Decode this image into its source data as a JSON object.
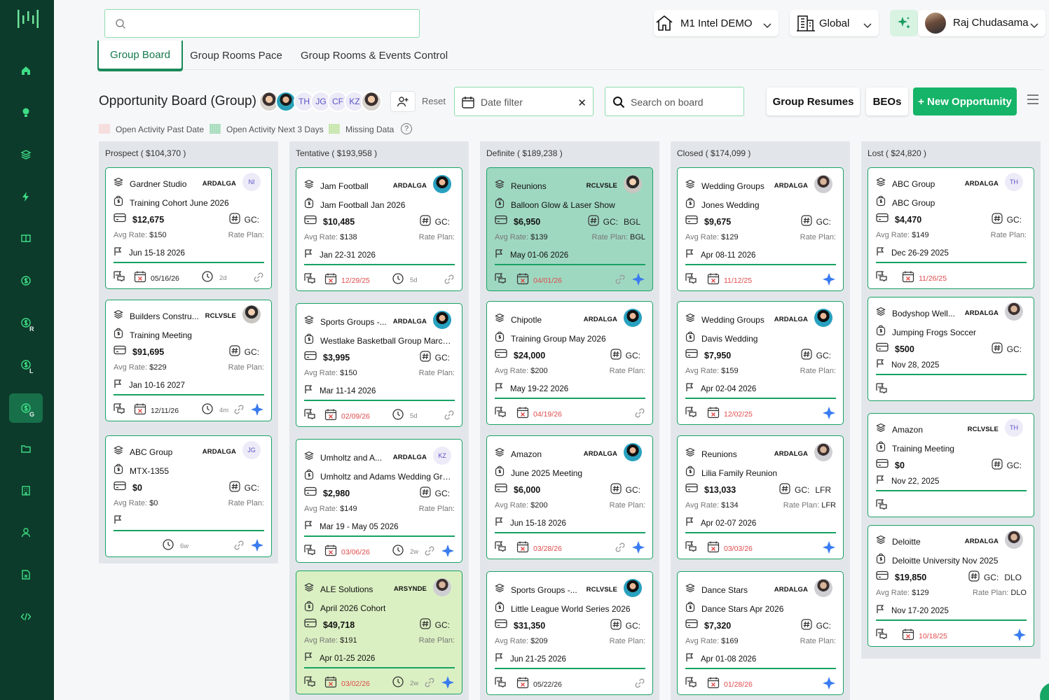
{
  "top": {
    "search_placeholder": "",
    "property": "M1 Intel DEMO",
    "scope": "Global",
    "user": "Raj Chudasama"
  },
  "tabs": [
    "Group Board",
    "Group Rooms Pace",
    "Group Rooms & Events Control"
  ],
  "board": {
    "title": "Opportunity Board (Group)",
    "avatar_initials": [
      "TH",
      "JG",
      "CF",
      "KZ"
    ],
    "reset": "Reset",
    "date_filter": "Date filter",
    "search_placeholder": "Search on board",
    "group_resumes": "Group Resumes",
    "beos": "BEOs",
    "new_opportunity": "+ New Opportunity"
  },
  "legend": {
    "items": [
      "Open Activity Past Date",
      "Open Activity Next 3 Days",
      "Missing Data"
    ],
    "help": "?",
    "colors": [
      "#f7dede",
      "#bfe6cf",
      "#d6eec1"
    ]
  },
  "colors": {
    "accent": "#17a263",
    "sidebar": "#0c3b2b",
    "danger": "#e04a4a",
    "spark": "#3a7bf0"
  },
  "labels": {
    "gc": "GC:",
    "avg_rate": "Avg Rate:",
    "rate_plan": "Rate Plan:"
  },
  "columns": [
    {
      "title": "Prospect ( $104,370 )",
      "cards": [
        {
          "company": "Gardner Studio",
          "code": "ARDALGA",
          "owner": "NI",
          "event": "Training Cohort June 2026",
          "amount": "$12,675",
          "gc": "",
          "avg_rate": "$150",
          "rate_plan": "",
          "dates": "Jun 15-18 2026",
          "foot_date": "05/16/26",
          "foot_date_red": false,
          "age": "2d",
          "link": true,
          "spark": false,
          "style": ""
        },
        {
          "company": "Builders Constru...",
          "code": "RCLVSLE",
          "owner": "",
          "owner_photo": "p1",
          "event": "Training Meeting",
          "amount": "$91,695",
          "gc": "",
          "avg_rate": "$229",
          "rate_plan": "",
          "dates": "Jan 10-16 2027",
          "foot_date": "12/11/26",
          "foot_date_red": false,
          "age": "4m",
          "link": true,
          "spark": true,
          "style": ""
        },
        {
          "company": "ABC Group",
          "code": "ARDALGA",
          "owner": "JG",
          "event": "MTX-1355",
          "amount": "$0",
          "gc": "",
          "avg_rate": "$0",
          "rate_plan": "",
          "dates": "",
          "foot_date": "",
          "foot_date_red": false,
          "age": "6w",
          "link": true,
          "spark": true,
          "style": ""
        }
      ]
    },
    {
      "title": "Tentative ( $193,958 )",
      "cards": [
        {
          "company": "Jam Football",
          "code": "ARDALGA",
          "owner": "",
          "owner_photo": "p2",
          "event": "Jam Football Jan 2026",
          "amount": "$10,485",
          "gc": "",
          "avg_rate": "$138",
          "rate_plan": "",
          "dates": "Jan 22-31 2026",
          "foot_date": "12/29/25",
          "foot_date_red": true,
          "age": "5d",
          "link": true,
          "spark": false,
          "style": ""
        },
        {
          "company": "Sports Groups -...",
          "code": "ARDALGA",
          "owner": "",
          "owner_photo": "p2",
          "event": "Westlake Basketball Group March ...",
          "amount": "$3,995",
          "gc": "",
          "avg_rate": "$150",
          "rate_plan": "",
          "dates": "Mar 11-14 2026",
          "foot_date": "02/09/26",
          "foot_date_red": true,
          "age": "5d",
          "link": true,
          "spark": false,
          "style": ""
        },
        {
          "company": "Umholtz and A...",
          "code": "ARDALGA",
          "owner": "KZ",
          "event": "Umholtz and Adams Wedding Gro...",
          "amount": "$2,980",
          "gc": "",
          "avg_rate": "$149",
          "rate_plan": "",
          "dates": "Mar 19 - May 05 2026",
          "foot_date": "03/06/26",
          "foot_date_red": true,
          "age": "2w",
          "link": true,
          "spark": true,
          "style": ""
        },
        {
          "company": "ALE Solutions",
          "code": "ARSYNDE",
          "owner": "",
          "owner_photo": "p3",
          "event": "April 2026 Cohort",
          "amount": "$49,718",
          "gc": "",
          "avg_rate": "$191",
          "rate_plan": "",
          "dates": "Apr 01-25 2026",
          "foot_date": "03/02/26",
          "foot_date_red": true,
          "age": "2w",
          "link": true,
          "spark": true,
          "style": "lime"
        }
      ]
    },
    {
      "title": "Definite ( $189,238 )",
      "cards": [
        {
          "company": "Reunions",
          "code": "RCLVSLE",
          "owner": "",
          "owner_photo": "p1",
          "event": "Balloon Glow & Laser Show",
          "amount": "$6,950",
          "gc": "BGL",
          "avg_rate": "$139",
          "rate_plan": "BGL",
          "dates": "May 01-06 2026",
          "foot_date": "04/01/26",
          "foot_date_red": true,
          "age": "",
          "link": true,
          "spark": true,
          "style": "green"
        },
        {
          "company": "Chipotle",
          "code": "ARDALGA",
          "owner": "",
          "owner_photo": "p2",
          "event": "Training Group May 2026",
          "amount": "$24,000",
          "gc": "",
          "avg_rate": "$200",
          "rate_plan": "",
          "dates": "May 19-22 2026",
          "foot_date": "04/19/26",
          "foot_date_red": true,
          "age": "",
          "link": true,
          "spark": false,
          "style": ""
        },
        {
          "company": "Amazon",
          "code": "ARDALGA",
          "owner": "",
          "owner_photo": "p2",
          "event": "June 2025 Meeting",
          "amount": "$6,000",
          "gc": "",
          "avg_rate": "$200",
          "rate_plan": "",
          "dates": "Jun 15-18 2026",
          "foot_date": "03/28/26",
          "foot_date_red": true,
          "age": "",
          "link": true,
          "spark": true,
          "style": ""
        },
        {
          "company": "Sports Groups -...",
          "code": "RCLVSLE",
          "owner": "",
          "owner_photo": "p2",
          "event": "Little League World Series 2026",
          "amount": "$31,350",
          "gc": "",
          "avg_rate": "$209",
          "rate_plan": "",
          "dates": "Jun 21-25 2026",
          "foot_date": "05/22/26",
          "foot_date_red": false,
          "age": "",
          "link": true,
          "spark": false,
          "style": ""
        }
      ]
    },
    {
      "title": "Closed ( $174,099 )",
      "cards": [
        {
          "company": "Wedding Groups",
          "code": "ARDALGA",
          "owner": "",
          "owner_photo": "p3",
          "event": "Jones Wedding",
          "amount": "$9,675",
          "gc": "",
          "avg_rate": "$129",
          "rate_plan": "",
          "dates": "Apr 08-11 2026",
          "foot_date": "11/12/25",
          "foot_date_red": true,
          "age": "",
          "link": false,
          "spark": true,
          "style": ""
        },
        {
          "company": "Wedding Groups",
          "code": "ARDALGA",
          "owner": "",
          "owner_photo": "p2",
          "event": "Davis Wedding",
          "amount": "$7,950",
          "gc": "",
          "avg_rate": "$159",
          "rate_plan": "",
          "dates": "Apr 02-04 2026",
          "foot_date": "12/02/25",
          "foot_date_red": true,
          "age": "",
          "link": false,
          "spark": true,
          "style": ""
        },
        {
          "company": "Reunions",
          "code": "ARDALGA",
          "owner": "",
          "owner_photo": "p3",
          "event": "Lilia Family Reunion",
          "amount": "$13,033",
          "gc": "LFR",
          "avg_rate": "$134",
          "rate_plan": "LFR",
          "dates": "Apr 02-07 2026",
          "foot_date": "03/03/26",
          "foot_date_red": true,
          "age": "",
          "link": false,
          "spark": true,
          "style": ""
        },
        {
          "company": "Dance Stars",
          "code": "ARDALGA",
          "owner": "",
          "owner_photo": "p3",
          "event": "Dance Stars Apr 2026",
          "amount": "$7,320",
          "gc": "",
          "avg_rate": "$169",
          "rate_plan": "",
          "dates": "Apr 01-08 2026",
          "foot_date": "01/28/26",
          "foot_date_red": true,
          "age": "",
          "link": false,
          "spark": true,
          "style": ""
        }
      ]
    },
    {
      "title": "Lost ( $24,820 )",
      "cards": [
        {
          "company": "ABC Group",
          "code": "ARDALGA",
          "owner": "TH",
          "event": "ABC Group",
          "amount": "$4,470",
          "gc": "",
          "avg_rate": "$149",
          "rate_plan": "",
          "dates": "Dec 26-29 2025",
          "foot_date": "11/26/25",
          "foot_date_red": true,
          "age": "",
          "link": false,
          "spark": false,
          "style": ""
        },
        {
          "company": "Bodyshop Well...",
          "code": "ARDALGA",
          "owner": "",
          "owner_photo": "p3",
          "event": "Jumping Frogs Soccer",
          "amount": "$500",
          "gc": "",
          "avg_rate": null,
          "rate_plan": null,
          "dates": "Nov 28, 2025",
          "foot_date": "",
          "foot_date_red": false,
          "age": "",
          "link": false,
          "spark": false,
          "style": ""
        },
        {
          "company": "Amazon",
          "code": "RCLVSLE",
          "owner": "TH",
          "event": "Training Meeting",
          "amount": "$0",
          "gc": "",
          "avg_rate": null,
          "rate_plan": null,
          "dates": "Nov 22, 2025",
          "foot_date": "",
          "foot_date_red": false,
          "age": "",
          "link": false,
          "spark": false,
          "style": ""
        },
        {
          "company": "Deloitte",
          "code": "ARDALGA",
          "owner": "",
          "owner_photo": "p3",
          "event": "Deloitte University Nov 2025",
          "amount": "$19,850",
          "gc": "DLO",
          "avg_rate": "$129",
          "rate_plan": "DLO",
          "dates": "Nov 17-20 2025",
          "foot_date": "10/18/25",
          "foot_date_red": true,
          "age": "",
          "link": false,
          "spark": true,
          "style": ""
        }
      ]
    }
  ]
}
